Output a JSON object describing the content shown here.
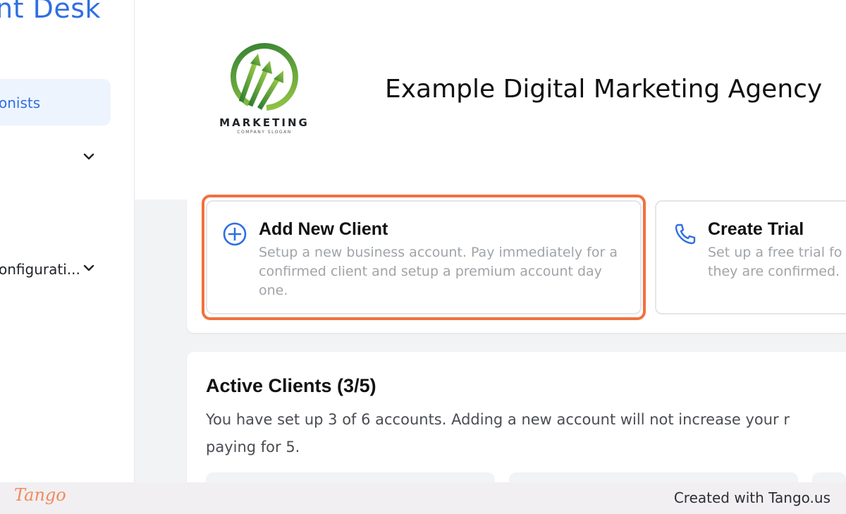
{
  "sidebar": {
    "app_title": "nt Desk",
    "items": [
      {
        "label": "onists",
        "active": true
      },
      {
        "label": "",
        "has_chevron": true
      },
      {
        "label": "onfigurati...",
        "has_chevron": true
      },
      {
        "label": "ı"
      }
    ]
  },
  "header": {
    "logo_text": "MARKETING",
    "logo_slogan": "COMPANY SLOGAN",
    "agency_name": "Example Digital Marketing Agency"
  },
  "actions": {
    "add_client": {
      "title": "Add New Client",
      "description": "Setup a new business account. Pay immediately for a confirmed client and setup a premium account day one.",
      "icon": "plus-circle-icon"
    },
    "create_trial": {
      "title": "Create Trial",
      "description": "Set up a free trial fo they are confirmed.",
      "description_line1": "Set up a free trial fo",
      "description_line2": "they are confirmed.",
      "icon": "phone-icon"
    }
  },
  "clients": {
    "title": "Active Clients (3/5)",
    "description": "You have set up 3 of 6 accounts. Adding a new account will not increase your r paying for 5.",
    "description_line1": "You have set up 3 of 6 accounts. Adding a new account will not increase your r",
    "description_line2": "paying for 5."
  },
  "footer": {
    "brand": "Tango",
    "credit": "Created with Tango.us"
  },
  "colors": {
    "accent": "#2f6fe3",
    "highlight": "#f2703e",
    "logo_green": "#5aa83a"
  }
}
